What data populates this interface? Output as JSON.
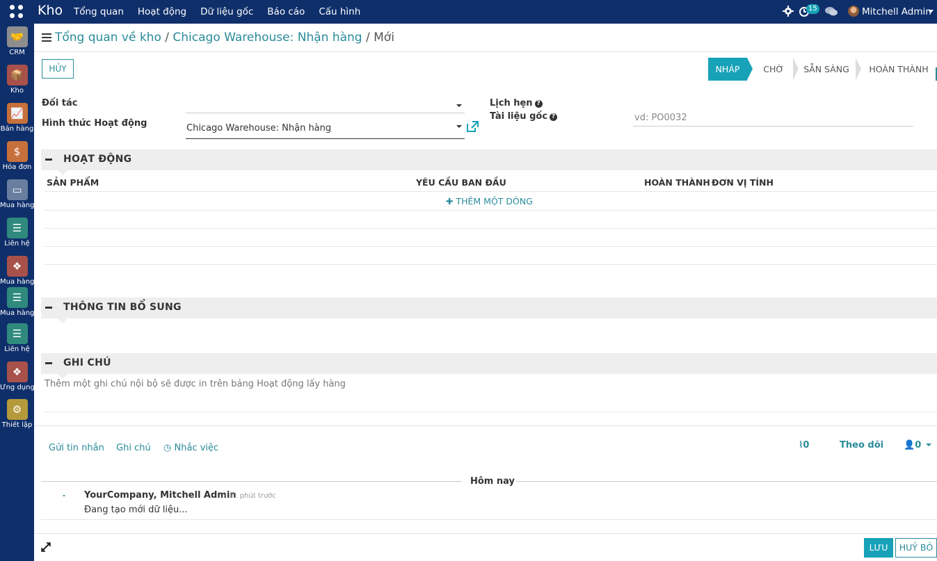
{
  "topbar": {
    "brand": "Kho",
    "menu": [
      "Tổng quan",
      "Hoạt động",
      "Dữ liệu gốc",
      "Báo cáo",
      "Cấu hình"
    ],
    "activity_count": "15",
    "user_name": "Mitchell Admin"
  },
  "sidebar": {
    "items": [
      {
        "label": "CRM",
        "icon": "handshake-icon",
        "color": "#8e8e8e",
        "glyph": "🤝"
      },
      {
        "label": "Kho",
        "icon": "box-icon",
        "color": "#a8514b",
        "glyph": "📦"
      },
      {
        "label": "Bán hàng",
        "icon": "chart-up-icon",
        "color": "#c7703c",
        "glyph": "📈"
      },
      {
        "label": "Hóa đơn",
        "icon": "invoice-icon",
        "color": "#c7703c",
        "glyph": "$"
      },
      {
        "label": "Mua hàng",
        "icon": "credit-card-icon",
        "color": "#6a7fa0",
        "glyph": "▭"
      },
      {
        "label": "Liên hệ",
        "icon": "contact-book-icon",
        "color": "#2f8a7d",
        "glyph": "☰"
      },
      {
        "label": "Mua hàng",
        "icon": "cubes-icon",
        "color": "#a8514b",
        "glyph": "❖"
      },
      {
        "label": "Mua hàng",
        "icon": "contact-book-icon",
        "color": "#2f8a7d",
        "glyph": "☰"
      },
      {
        "label": "Liên hệ",
        "icon": "contact-book-icon",
        "color": "#2f8a7d",
        "glyph": "☰"
      },
      {
        "label": "Ứng dụng",
        "icon": "cubes-icon",
        "color": "#a8514b",
        "glyph": "❖"
      },
      {
        "label": "Thiết lập",
        "icon": "settings-gear-icon",
        "color": "#b59a3c",
        "glyph": "⚙"
      }
    ]
  },
  "breadcrumb": {
    "level1": "Tổng quan về kho",
    "level2": "Chicago Warehouse: Nhận hàng",
    "current": "Mới",
    "sep": "/"
  },
  "buttons": {
    "cancel_top": "HỦY",
    "save": "LƯU",
    "discard": "HUỶ BỎ"
  },
  "statusbar": {
    "stages": [
      "NHÁP",
      "CHỜ",
      "SẴN SÀNG",
      "HOÀN THÀNH"
    ],
    "active": "NHÁP"
  },
  "form": {
    "partner_label": "Đối tác",
    "partner_value": "",
    "operation_type_label": "Hình thức Hoạt động",
    "operation_type_value": "Chicago Warehouse: Nhận hàng",
    "scheduled_label": "Lịch hẹn",
    "source_doc_label": "Tài liệu gốc",
    "source_doc_placeholder": "vd: PO0032"
  },
  "sections": {
    "operations": "HOẠT ĐỘNG",
    "additional_info": "THÔNG TIN BỔ SUNG",
    "notes": "GHI CHÚ"
  },
  "table": {
    "headers": [
      "SẢN PHẨM",
      "YÊU CẦU BAN ĐẦU",
      "HOÀN THÀNH",
      "ĐƠN VỊ TÍNH"
    ],
    "add_line": "THÊM MỘT DÒNG"
  },
  "notes": {
    "placeholder": "Thêm một ghi chú nội bộ sẽ được in trên bảng Hoạt động lấy hàng"
  },
  "chatter": {
    "send_message": "Gửi tin nhắn",
    "log_note": "Ghi chú",
    "schedule_activity": "Nhắc việc",
    "attachments": "0",
    "follow": "Theo dõi",
    "followers": "0",
    "today": "Hôm nay",
    "author": "YourCompany, Mitchell Admin",
    "time": "- 11 phút trước",
    "body": "Đang tạo mới dữ liệu..."
  }
}
